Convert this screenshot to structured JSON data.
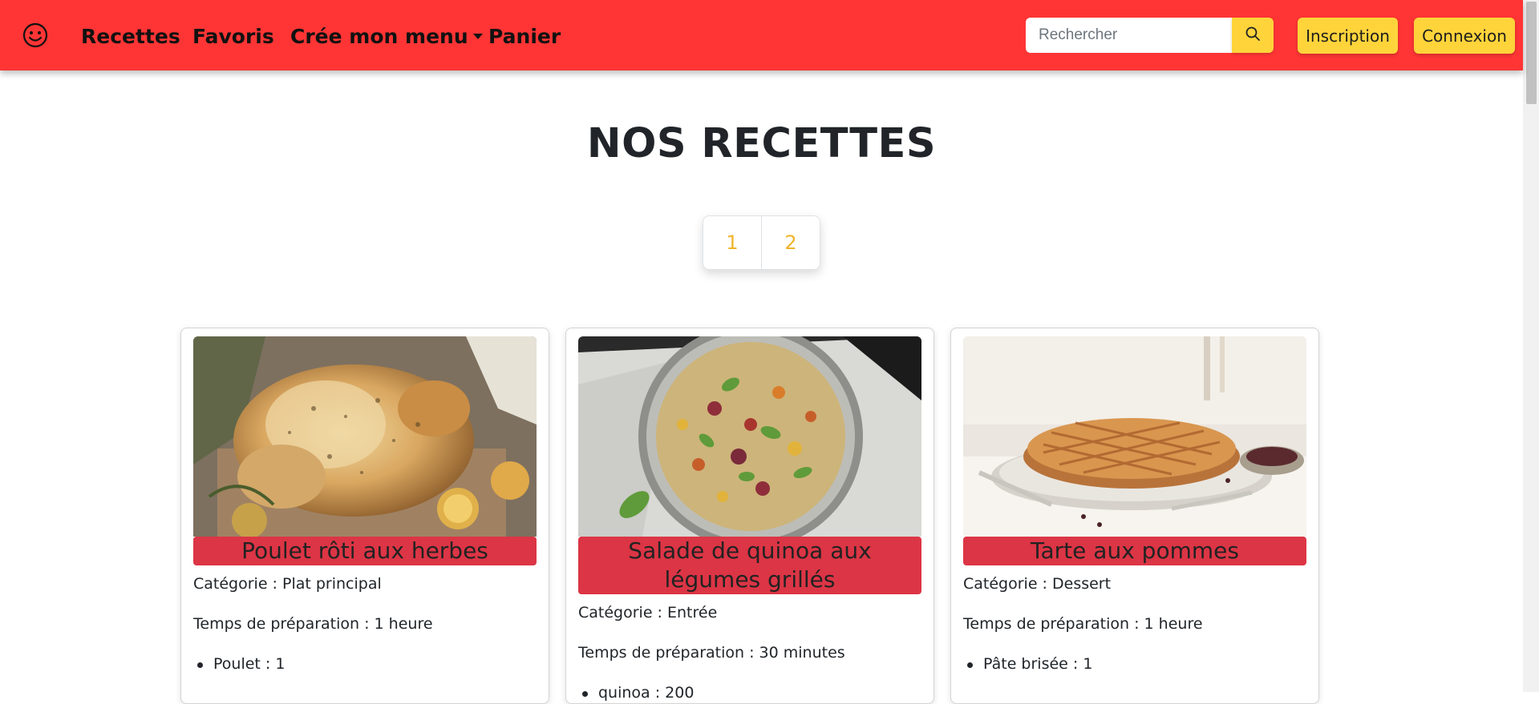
{
  "nav": {
    "brand_icon": "smiley-icon",
    "links": [
      "Recettes",
      "Favoris",
      "Crée mon menu",
      "Panier"
    ],
    "search_placeholder": "Rechercher",
    "search_icon": "search-icon",
    "inscription": "Inscription",
    "connexion": "Connexion"
  },
  "colors": {
    "navbar": "#ff3535",
    "accent_yellow": "#ffd43b",
    "card_title_bg": "#dc3545",
    "pagination_text": "#f0b429"
  },
  "main": {
    "title": "NOS RECETTES",
    "pages": [
      "1",
      "2"
    ]
  },
  "recipes": [
    {
      "title": "Poulet rôti aux herbes",
      "category": "Catégorie : Plat principal",
      "time": "Temps de préparation : 1 heure",
      "ingredients": [
        "Poulet : 1"
      ]
    },
    {
      "title": "Salade de quinoa aux légumes grillés",
      "category": "Catégorie : Entrée",
      "time": "Temps de préparation : 30 minutes",
      "ingredients": [
        "quinoa : 200"
      ]
    },
    {
      "title": "Tarte aux pommes",
      "category": "Catégorie : Dessert",
      "time": "Temps de préparation : 1 heure",
      "ingredients": [
        "Pâte brisée : 1"
      ]
    }
  ]
}
